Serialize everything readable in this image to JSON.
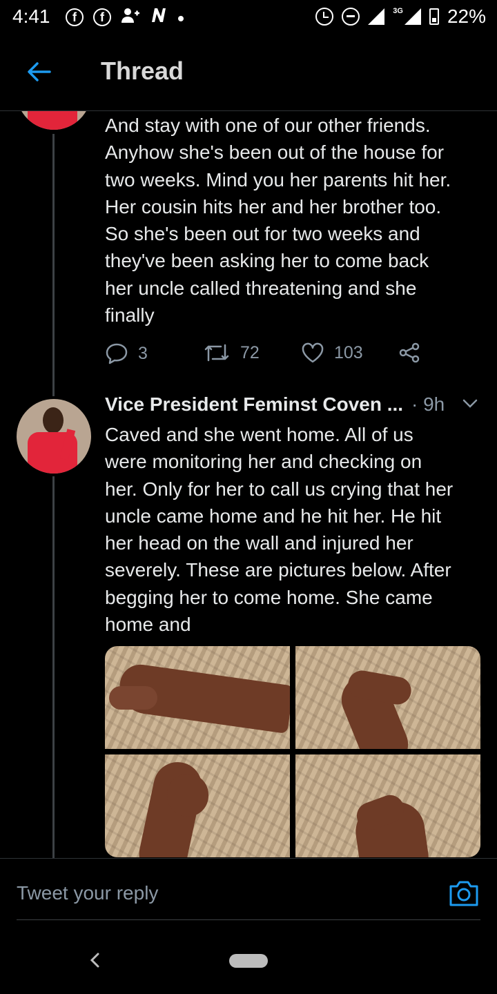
{
  "status_bar": {
    "time": "4:41",
    "network": "3G",
    "battery": "22%",
    "notification_icons": [
      "facebook-icon",
      "facebook-icon",
      "add-user-icon",
      "n-icon",
      "dot-icon"
    ],
    "right_icons": [
      "alarm-icon",
      "dnd-icon",
      "signal-icon",
      "signal-icon",
      "battery-charging-icon"
    ]
  },
  "header": {
    "title": "Thread"
  },
  "tweets": [
    {
      "text": "And stay with one of our other friends.\nAnyhow she's been out of the house for\ntwo weeks. Mind you her parents hit her.\nHer cousin hits her and her brother too.\nSo she's been out for two weeks and\nthey've been asking her to come back\nher uncle called threatening and she\nfinally",
      "replies": "3",
      "retweets": "72",
      "likes": "103"
    },
    {
      "author": "Vice President Feminst Coven ...",
      "time": "· 9h",
      "text": "Caved and she went home. All of us\nwere monitoring her and checking on\nher. Only for her to call us crying that her\nuncle came home and he hit her. He hit\nher head on the wall and injured her\nseverely. These are pictures below. After\nbegging her to come home. She came\nhome and",
      "media_count": 4
    }
  ],
  "reply_bar": {
    "placeholder": "Tweet your reply"
  },
  "colors": {
    "background": "#000000",
    "accent": "#1d9bf0",
    "secondary_text": "#8b98a5",
    "avatar_shirt": "#e2253a"
  }
}
